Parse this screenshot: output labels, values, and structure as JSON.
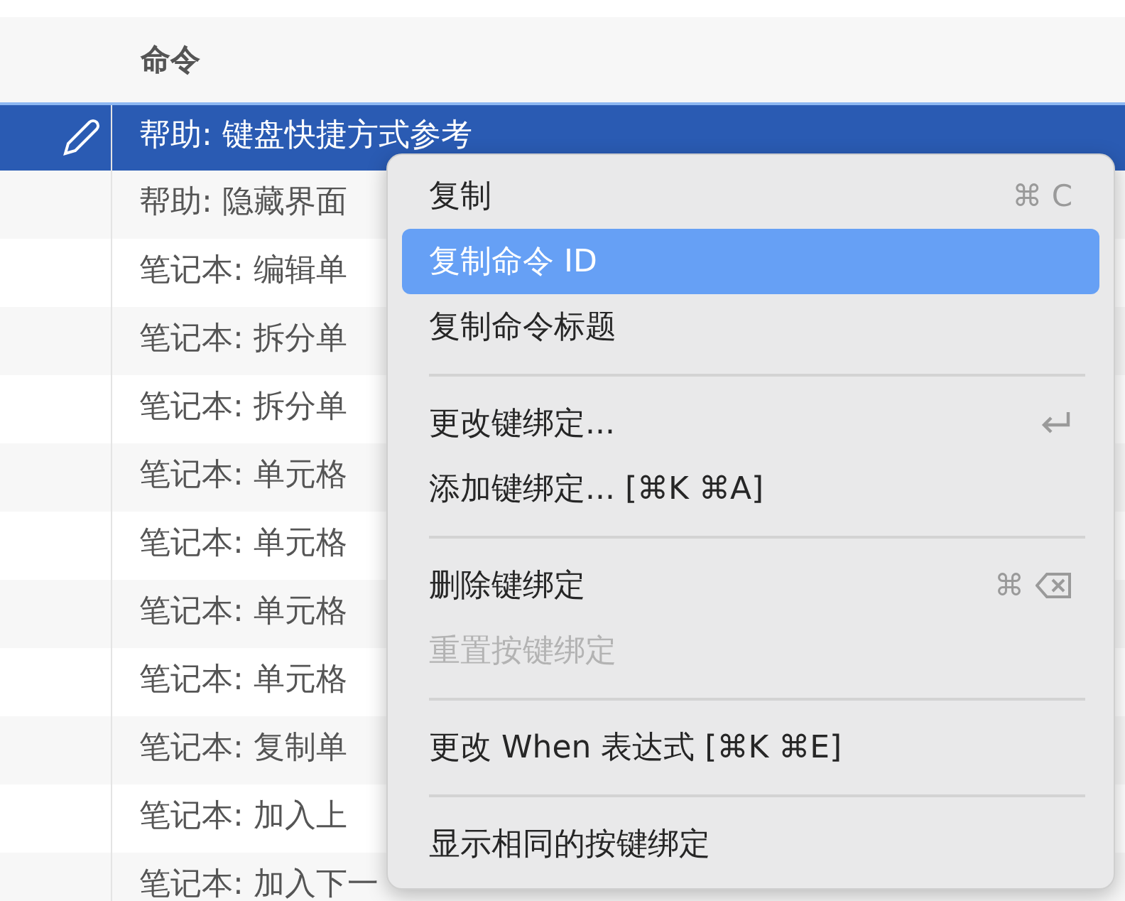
{
  "table": {
    "columns": [
      "命令"
    ],
    "rows": [
      {
        "command": "帮助: 键盘快捷方式参考",
        "selected": true
      },
      {
        "command": "帮助: 隐藏界面",
        "selected": false
      },
      {
        "command": "笔记本: 编辑单",
        "selected": false
      },
      {
        "command": "笔记本: 拆分单",
        "selected": false
      },
      {
        "command": "笔记本: 拆分单",
        "selected": false
      },
      {
        "command": "笔记本: 单元格",
        "selected": false
      },
      {
        "command": "笔记本: 单元格",
        "selected": false
      },
      {
        "command": "笔记本: 单元格",
        "selected": false
      },
      {
        "command": "笔记本: 单元格",
        "selected": false
      },
      {
        "command": "笔记本: 复制单",
        "selected": false
      },
      {
        "command": "笔记本: 加入上",
        "selected": false
      },
      {
        "command": "笔记本: 加入下一",
        "selected": false
      }
    ]
  },
  "context_menu": {
    "items": [
      {
        "kind": "item",
        "label": "复制",
        "selected": false,
        "disabled": false,
        "shortcut": {
          "text": "⌘ C"
        }
      },
      {
        "kind": "item",
        "label": "复制命令 ID",
        "selected": true,
        "disabled": false
      },
      {
        "kind": "item",
        "label": "复制命令标题",
        "selected": false,
        "disabled": false
      },
      {
        "kind": "separator"
      },
      {
        "kind": "item",
        "label": "更改键绑定...",
        "selected": false,
        "disabled": false,
        "shortcut": {
          "kind": "return"
        }
      },
      {
        "kind": "item",
        "label": "添加键绑定... [⌘K ⌘A]",
        "selected": false,
        "disabled": false
      },
      {
        "kind": "separator"
      },
      {
        "kind": "item",
        "label": "删除键绑定",
        "selected": false,
        "disabled": false,
        "shortcut": {
          "text": "⌘",
          "kind": "delete"
        }
      },
      {
        "kind": "item",
        "label": "重置按键绑定",
        "selected": false,
        "disabled": true
      },
      {
        "kind": "separator"
      },
      {
        "kind": "item",
        "label": "更改 When 表达式 [⌘K ⌘E]",
        "selected": false,
        "disabled": false
      },
      {
        "kind": "separator"
      },
      {
        "kind": "item",
        "label": "显示相同的按键绑定",
        "selected": false,
        "disabled": false
      }
    ]
  }
}
